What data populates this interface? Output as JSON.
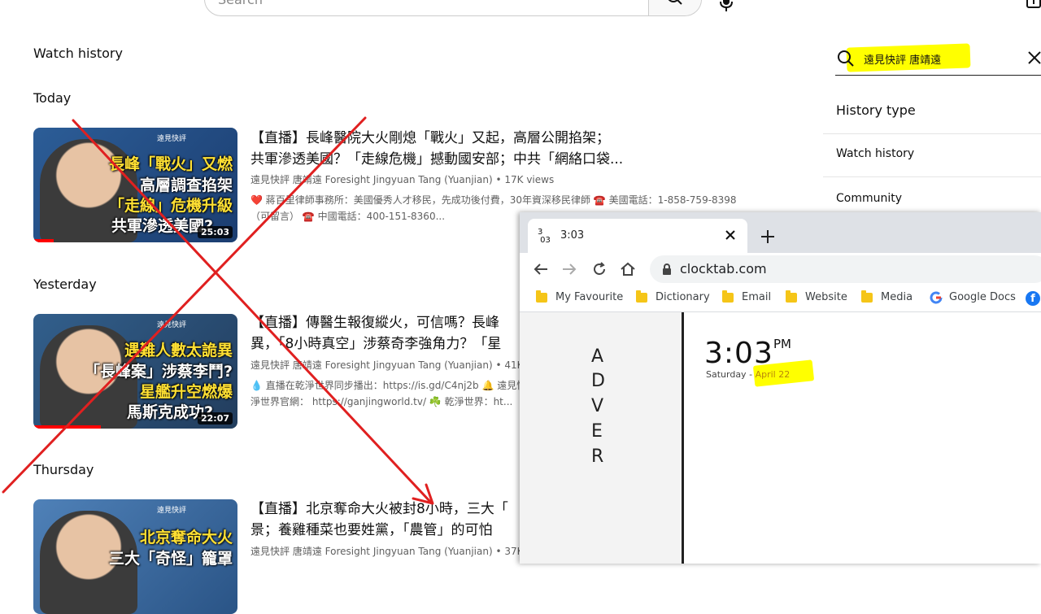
{
  "topbar": {
    "search_placeholder": "Search",
    "search_icon": "search-icon",
    "mic_icon": "mic-icon",
    "create_icon": "create-icon"
  },
  "page": {
    "title": "Watch history",
    "sections": {
      "today": "Today",
      "yesterday": "Yesterday",
      "thursday": "Thursday"
    }
  },
  "videos": [
    {
      "title_line1": "【直播】長峰醫院大火剛熄「戰火」又起，高層公開掐架；",
      "title_line2": "共軍滲透美國？「走線危機」撼動國安部；中共「網絡口袋...",
      "channel": "遠見快評 唐靖遠 Foresight Jingyuan Tang (Yuanjian)",
      "views": "17K views",
      "desc_line1": "❤️ 蔣百里律師事務所：美國優秀人才移民，先成功後付費，30年資深移民律師 ☎️ 美國電話：1-858-759-8398",
      "desc_line2": "（可留言） ☎️ 中國電話：400-151-8360...",
      "duration": "25:03",
      "progress": 0.1,
      "thumb_text": [
        "長峰「戰火」又燃",
        "高層調查掐架",
        "「走線」危機升級",
        "共軍滲透美國?"
      ],
      "thumb_brand": "遠見快評"
    },
    {
      "title_line1": "【直播】傳醫生報復縱火，可信嗎？長峰",
      "title_line2": "異，「8小時真空」涉蔡奇李強角力？「星",
      "channel": "遠見快評 唐靖遠 Foresight Jingyuan Tang (Yuanjian)",
      "views": "41K vie",
      "desc_line1": "💧 直播在乾淨世界同步播出：https://is.gd/C4nj2b 🔔 遠見快評",
      "desc_line2": "淨世界官網： https://ganjingworld.tv/ ☘️ 乾淨世界：ht...",
      "duration": "22:07",
      "progress": 0.33,
      "thumb_text": [
        "遇難人數太詭異",
        "「長峰案」涉蔡李鬥?",
        "星艦升空燃爆",
        "馬斯克成功?"
      ],
      "thumb_brand": "遠見快評"
    },
    {
      "title_line1": "【直播】北京奪命大火被封8小時，三大「",
      "title_line2": "景；養雞種菜也要姓黨，「農管」的可怕",
      "channel": "遠見快評 唐靖遠 Foresight Jingyuan Tang (Yuanjian)",
      "views": "37K vie",
      "duration": "",
      "progress": 0,
      "thumb_text": [
        "北京奪命大火",
        "三大「奇怪」籠罩"
      ],
      "thumb_brand": "遠見快評"
    }
  ],
  "filter_panel": {
    "search_value": "遠見快評 唐靖遠",
    "search_icon": "search-icon",
    "clear_icon": "close-icon",
    "items": [
      "History type",
      "Watch history",
      "Community"
    ]
  },
  "browser": {
    "tab": {
      "favicon_text": "3\n03",
      "title": "3:03",
      "close_icon": "close-icon"
    },
    "new_tab_icon": "plus-icon",
    "url": "clocktab.com",
    "bookmarks": [
      "My Favourite",
      "Dictionary",
      "Email",
      "Website",
      "Media",
      "Google Docs"
    ],
    "ad_letters": [
      "A",
      "D",
      "V",
      "E",
      "R"
    ],
    "clock": {
      "time": "3:03",
      "ampm": "PM",
      "weekday": "Saturday",
      "separator": "-",
      "date": "April 22"
    }
  },
  "colors": {
    "annotation": "#e02020",
    "highlight": "#ffff00",
    "progress": "#ff0000"
  }
}
